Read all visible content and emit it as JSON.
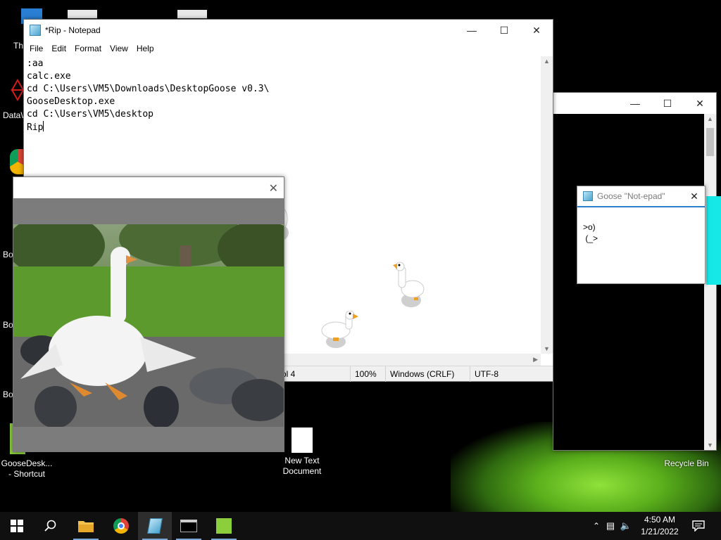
{
  "desktop": {
    "icons": [
      {
        "label": "GooseDesk...\n- Shortcut"
      },
      {
        "label": "New Text\nDocument"
      },
      {
        "label": "Recycle Bin"
      }
    ],
    "partial_labels": [
      "Th",
      "DataW",
      "Bo",
      "Bo",
      "Bo"
    ]
  },
  "notepad": {
    "title": "*Rip - Notepad",
    "menu": [
      "File",
      "Edit",
      "Format",
      "View",
      "Help"
    ],
    "lines": [
      ":aa",
      "calc.exe",
      "cd C:\\Users\\VM5\\Downloads\\DesktopGoose v0.3\\",
      "GooseDesktop.exe",
      "cd C:\\Users\\VM5\\desktop",
      "Rip"
    ],
    "status": {
      "position": "ol 4",
      "zoom": "100%",
      "line_ending": "Windows (CRLF)",
      "encoding": "UTF-8"
    }
  },
  "goose_note": {
    "title": "Goose \"Not-epad\"",
    "text": ">o)\n (_>"
  },
  "taskbar": {
    "clock_time": "4:50 AM",
    "clock_date": "1/21/2022"
  },
  "colors": {
    "accent_cyan": "#16e8e8",
    "note_border": "#2c7ec8",
    "taskbar_bg": "#101010"
  }
}
